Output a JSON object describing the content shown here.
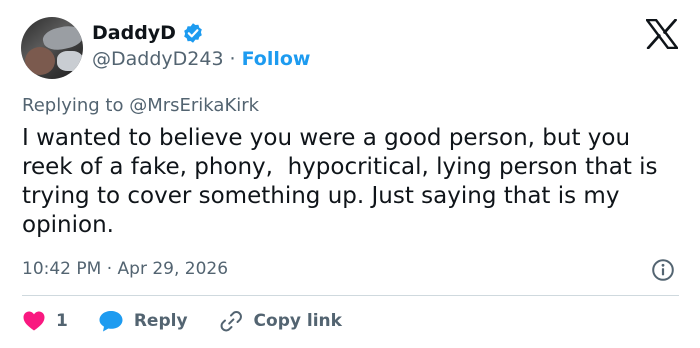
{
  "author": {
    "display_name": "DaddyD",
    "handle": "@DaddyD243",
    "separator": "·",
    "follow_label": "Follow"
  },
  "reply_context": {
    "prefix": "Replying to",
    "mention": "@MrsErikaKirk"
  },
  "tweet": {
    "text": "I wanted to believe you were a good person, but you reek of a fake, phony,  hypocritical, lying person that is trying to cover something up. Just saying that is my opinion.",
    "timestamp": "10:42 PM · Apr 29, 2026"
  },
  "actions": {
    "like_count": "1",
    "reply_label": "Reply",
    "copy_link_label": "Copy link"
  },
  "colors": {
    "accent": "#1d9bf0",
    "like": "#f91880",
    "secondary_text": "#536471"
  },
  "icons": [
    "verified-badge-icon",
    "x-logo-icon",
    "info-icon",
    "heart-icon",
    "reply-bubble-icon",
    "link-icon"
  ]
}
